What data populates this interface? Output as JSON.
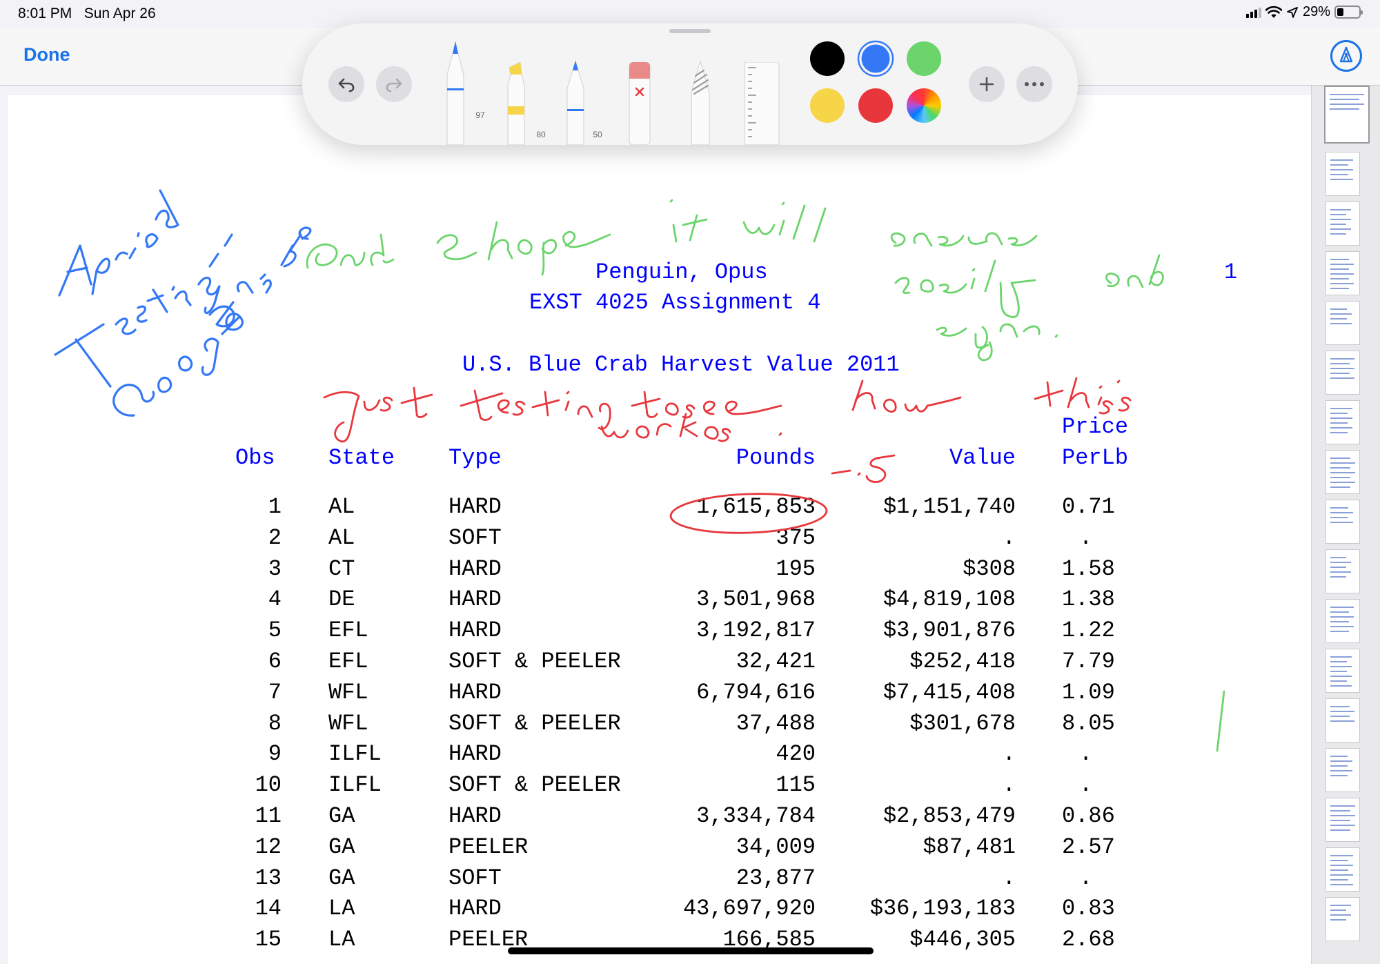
{
  "status_bar": {
    "time": "8:01 PM",
    "date": "Sun Apr 26",
    "battery": "29%",
    "battery_level": 0.29
  },
  "nav": {
    "done_label": "Done",
    "markup_icon": "pen-tip-circle-icon"
  },
  "toolbar": {
    "tools": [
      {
        "name": "pen",
        "width_label": "97",
        "ink_color": "#3478f6"
      },
      {
        "name": "marker",
        "width_label": "80",
        "ink_color": "#f6d548"
      },
      {
        "name": "pencil",
        "width_label": "50",
        "ink_color": "#3478f6"
      },
      {
        "name": "eraser",
        "width_label": ""
      },
      {
        "name": "lasso",
        "width_label": ""
      },
      {
        "name": "ruler",
        "width_label": ""
      }
    ],
    "colors": [
      "#000000",
      "#3478f6",
      "#6bd46b",
      "#f6d548",
      "#e8373c",
      "color-wheel"
    ],
    "selected_color": "#3478f6"
  },
  "document": {
    "header_name": "Penguin, Opus",
    "header_course": "EXST 4025 Assignment 4",
    "page_number": "1",
    "table_title": "U.S. Blue Crab Harvest Value 2011",
    "columns": {
      "obs": "Obs",
      "state": "State",
      "type": "Type",
      "pounds": "Pounds",
      "value": "Value",
      "price_line1": "Price",
      "price_line2": "PerLb"
    },
    "rows": [
      {
        "obs": "1",
        "state": "AL",
        "type": "HARD",
        "pounds": "1,615,853",
        "value": "$1,151,740",
        "price": "0.71"
      },
      {
        "obs": "2",
        "state": "AL",
        "type": "SOFT",
        "pounds": "375",
        "value": ".",
        "price": "."
      },
      {
        "obs": "3",
        "state": "CT",
        "type": "HARD",
        "pounds": "195",
        "value": "$308",
        "price": "1.58"
      },
      {
        "obs": "4",
        "state": "DE",
        "type": "HARD",
        "pounds": "3,501,968",
        "value": "$4,819,108",
        "price": "1.38"
      },
      {
        "obs": "5",
        "state": "EFL",
        "type": "HARD",
        "pounds": "3,192,817",
        "value": "$3,901,876",
        "price": "1.22"
      },
      {
        "obs": "6",
        "state": "EFL",
        "type": "SOFT & PEELER",
        "pounds": "32,421",
        "value": "$252,418",
        "price": "7.79"
      },
      {
        "obs": "7",
        "state": "WFL",
        "type": "HARD",
        "pounds": "6,794,616",
        "value": "$7,415,408",
        "price": "1.09"
      },
      {
        "obs": "8",
        "state": "WFL",
        "type": "SOFT & PEELER",
        "pounds": "37,488",
        "value": "$301,678",
        "price": "8.05"
      },
      {
        "obs": "9",
        "state": "ILFL",
        "type": "HARD",
        "pounds": "420",
        "value": ".",
        "price": "."
      },
      {
        "obs": "10",
        "state": "ILFL",
        "type": "SOFT & PEELER",
        "pounds": "115",
        "value": ".",
        "price": "."
      },
      {
        "obs": "11",
        "state": "GA",
        "type": "HARD",
        "pounds": "3,334,784",
        "value": "$2,853,479",
        "price": "0.86"
      },
      {
        "obs": "12",
        "state": "GA",
        "type": "PEELER",
        "pounds": "34,009",
        "value": "$87,481",
        "price": "2.57"
      },
      {
        "obs": "13",
        "state": "GA",
        "type": "SOFT",
        "pounds": "23,877",
        "value": ".",
        "price": "."
      },
      {
        "obs": "14",
        "state": "LA",
        "type": "HARD",
        "pounds": "43,697,920",
        "value": "$36,193,183",
        "price": "0.83"
      },
      {
        "obs": "15",
        "state": "LA",
        "type": "PEELER",
        "pounds": "166,585",
        "value": "$446,305",
        "price": "2.68"
      }
    ]
  },
  "annotations": [
    {
      "color": "#3478f6",
      "text": "April 26 Testing in Google Drive"
    },
    {
      "color": "#6bd46b",
      "text": "And I hope it will save easily and sync."
    },
    {
      "color": "#e8373c",
      "text": "Just testing to see how this works."
    },
    {
      "color": "#e8373c",
      "text": "-.5"
    }
  ],
  "thumbnails": {
    "count": 17,
    "active_index": 0
  }
}
